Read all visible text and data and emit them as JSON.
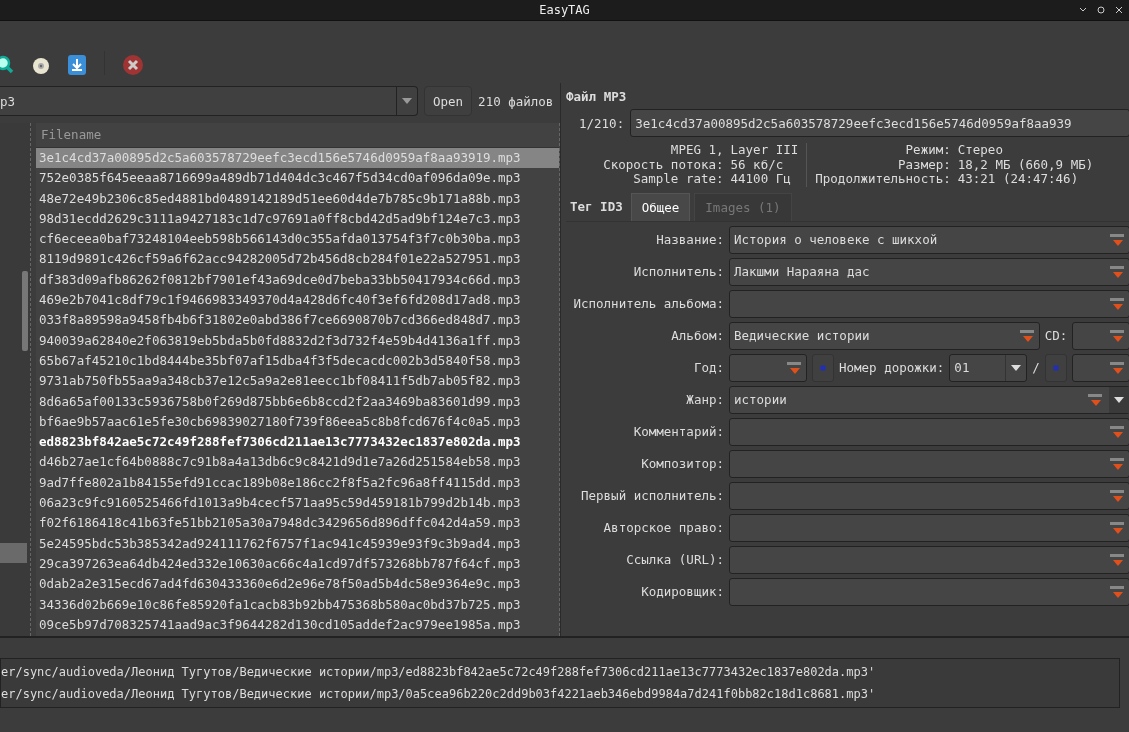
{
  "window": {
    "title": "EasyTAG"
  },
  "path": {
    "value": "p3",
    "open_button": "Open",
    "file_count": "210 файлов"
  },
  "file_list": {
    "column": "Filename",
    "rows": [
      {
        "name": "3e1c4cd37a00895d2c5a603578729eefc3ecd156e5746d0959af8aa93919.mp3",
        "selected": true,
        "modified": false
      },
      {
        "name": "752e0385f645eeaa8716699a489db71d404dc3c467f5d34cd0af096da09e.mp3",
        "selected": false,
        "modified": false
      },
      {
        "name": "48e72e49b2306c85ed4881bd0489142189d51ee60d4de7b785c9b171a88b.mp3",
        "selected": false,
        "modified": false
      },
      {
        "name": "98d31ecdd2629c3111a9427183c1d7c97691a0ff8cbd42d5ad9bf124e7c3.mp3",
        "selected": false,
        "modified": false
      },
      {
        "name": "cf6eceea0baf73248104eeb598b566143d0c355afda013754f3f7c0b30ba.mp3",
        "selected": false,
        "modified": false
      },
      {
        "name": "8119d9891c426cf59a6f62acc94282005d72b456d8cb284f01e22a527951.mp3",
        "selected": false,
        "modified": false
      },
      {
        "name": "df383d09afb86262f0812bf7901ef43a69dce0d7beba33bb50417934c66d.mp3",
        "selected": false,
        "modified": false
      },
      {
        "name": "469e2b7041c8df79c1f9466983349370d4a428d6fc40f3ef6fd208d17ad8.mp3",
        "selected": false,
        "modified": false
      },
      {
        "name": "033f8a89598a9458fb4b6f31802e0abd386f7ce6690870b7cd366ed848d7.mp3",
        "selected": false,
        "modified": false
      },
      {
        "name": "940039a62840e2f063819eb5bda5b0fd8832d2f3d732f4e59b4d4136a1ff.mp3",
        "selected": false,
        "modified": false
      },
      {
        "name": "65b67af45210c1bd8444be35bf07af15dba4f3f5decacdc002b3d5840f58.mp3",
        "selected": false,
        "modified": false
      },
      {
        "name": "9731ab750fb55aa9a348cb37e12c5a9a2e81eecc1bf08411f5db7ab05f82.mp3",
        "selected": false,
        "modified": false
      },
      {
        "name": "8d6a65af00133c5936758b0f269d875bb6e6b8ccd2f2aa3469ba83601d99.mp3",
        "selected": false,
        "modified": false
      },
      {
        "name": "bf6ae9b57aac61e5fe30cb69839027180f739f86eea5c8b8fcd676f4c0a5.mp3",
        "selected": false,
        "modified": false
      },
      {
        "name": "ed8823bf842ae5c72c49f288fef7306cd211ae13c7773432ec1837e802da.mp3",
        "selected": false,
        "modified": true
      },
      {
        "name": "d46b27ae1cf64b0888c7c91b8a4a13db6c9c8421d9d1e7a26d251584eb58.mp3",
        "selected": false,
        "modified": false
      },
      {
        "name": "9ad7ffe802a1b84155efd91ccac189b08e186cc2f8f5a2fc96a8ff4115dd.mp3",
        "selected": false,
        "modified": false
      },
      {
        "name": "06a23c9fc9160525466fd1013a9b4cecf571aa95c59d459181b799d2b14b.mp3",
        "selected": false,
        "modified": false
      },
      {
        "name": "f02f6186418c41b63fe51bb2105a30a7948dc3429656d896dffc042d4a59.mp3",
        "selected": false,
        "modified": false
      },
      {
        "name": "5e24595bdc53b385342ad924111762f6757f1ac941c45939e93f9c3b9ad4.mp3",
        "selected": false,
        "modified": false
      },
      {
        "name": "29ca397263ea64db424ed332e10630ac66c4a1cd97df573268bb787f64cf.mp3",
        "selected": false,
        "modified": false
      },
      {
        "name": "0dab2a2e315ecd67ad4fd630433360e6d2e96e78f50ad5b4dc58e9364e9c.mp3",
        "selected": false,
        "modified": false
      },
      {
        "name": "34336d02b669e10c86fe85920fa1cacb83b92bb475368b580ac0bd37b725.mp3",
        "selected": false,
        "modified": false
      },
      {
        "name": "09ce5b97d708325741aad9ac3f9644282d130cd105addef2ac979ee1985a.mp3",
        "selected": false,
        "modified": false
      }
    ]
  },
  "file_panel": {
    "title": "Файл MP3",
    "index": "1/210:",
    "filename": "3e1c4cd37a00895d2c5a603578729eefc3ecd156e5746d0959af8aa939",
    "info_left": [
      {
        "label": "MPEG 1,",
        "value": "Layer III"
      },
      {
        "label": "Скорость потока:",
        "value": "56 кб/с"
      },
      {
        "label": "Sample rate:",
        "value": "44100 Гц"
      }
    ],
    "info_right": [
      {
        "label": "Режим:",
        "value": "Стерео"
      },
      {
        "label": "Размер:",
        "value": "18,2 МБ (660,9 МБ)"
      },
      {
        "label": "Продолжительность:",
        "value": "43:21 (24:47:46)"
      }
    ]
  },
  "tag_section": {
    "title": "Тег ID3",
    "tabs": [
      {
        "label": "Общее",
        "selected": true,
        "disabled": false
      },
      {
        "label": "Images (1)",
        "selected": false,
        "disabled": true
      }
    ]
  },
  "fields": [
    {
      "kind": "text",
      "label": "Название:",
      "value": "История о человеке с шикхой"
    },
    {
      "kind": "text",
      "label": "Исполнитель:",
      "value": "Лакшми Нараяна дас"
    },
    {
      "kind": "text",
      "label": "Исполнитель альбома:"
    },
    {
      "kind": "album",
      "label": "Альбом:",
      "value": "Ведические истории",
      "extra_label": "CD:"
    },
    {
      "kind": "year",
      "label": "Год:",
      "extra_label": "Номер дорожки:",
      "track": "01",
      "separator": "/"
    },
    {
      "kind": "combo",
      "label": "Жанр:",
      "value": "истории"
    },
    {
      "kind": "text",
      "label": "Комментарий:"
    },
    {
      "kind": "text",
      "label": "Композитор:"
    },
    {
      "kind": "text",
      "label": "Первый исполнитель:"
    },
    {
      "kind": "text",
      "label": "Авторское право:"
    },
    {
      "kind": "text",
      "label": "Ссылка (URL):"
    },
    {
      "kind": "text",
      "label": "Кодировщик:"
    }
  ],
  "log": [
    "er/sync/audioveda/Леонид Тугутов/Ведические истории/mp3/ed8823bf842ae5c72c49f288fef7306cd211ae13c7773432ec1837e802da.mp3'",
    "er/sync/audioveda/Леонид Тугутов/Ведические истории/mp3/0a5cea96b220c2dd9b03f4221aeb346ebd9984a7d241f0bb82c18d1c8681.mp3'"
  ]
}
